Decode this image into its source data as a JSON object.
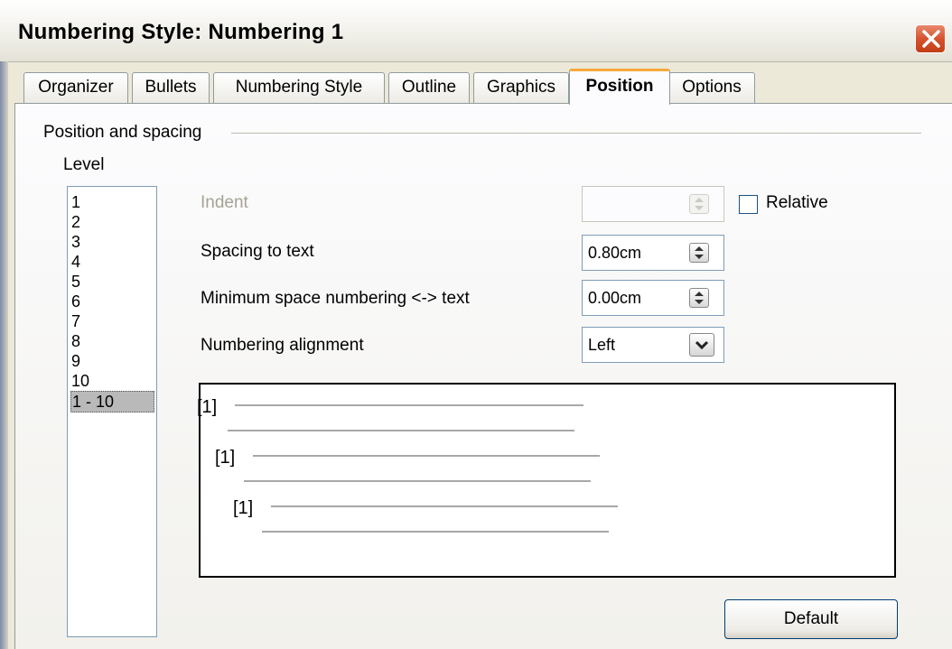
{
  "window": {
    "title": "Numbering Style: Numbering 1"
  },
  "tabs": [
    {
      "label": "Organizer"
    },
    {
      "label": "Bullets"
    },
    {
      "label": "Numbering Style"
    },
    {
      "label": "Outline"
    },
    {
      "label": "Graphics"
    },
    {
      "label": "Position",
      "active": true
    },
    {
      "label": "Options"
    }
  ],
  "section": {
    "title": "Position and spacing"
  },
  "level": {
    "label": "Level",
    "items": [
      "1",
      "2",
      "3",
      "4",
      "5",
      "6",
      "7",
      "8",
      "9",
      "10",
      "1 - 10"
    ],
    "selected": "1 - 10"
  },
  "fields": {
    "indent": {
      "label": "Indent",
      "value": "",
      "enabled": false
    },
    "relative": {
      "label": "Relative",
      "checked": false
    },
    "spacing_to_text": {
      "label": "Spacing to text",
      "value": "0.80cm"
    },
    "min_space": {
      "label": "Minimum space numbering <-> text",
      "value": "0.00cm"
    },
    "alignment": {
      "label": "Numbering alignment",
      "value": "Left"
    }
  },
  "preview": {
    "markers": [
      "[1]",
      "[1]",
      "[1]"
    ]
  },
  "buttons": {
    "default": "Default"
  },
  "colors": {
    "active_tab_accent": "#f7a83c",
    "close_button": "#d5532e",
    "dialog_bg": "#ece9d8"
  }
}
